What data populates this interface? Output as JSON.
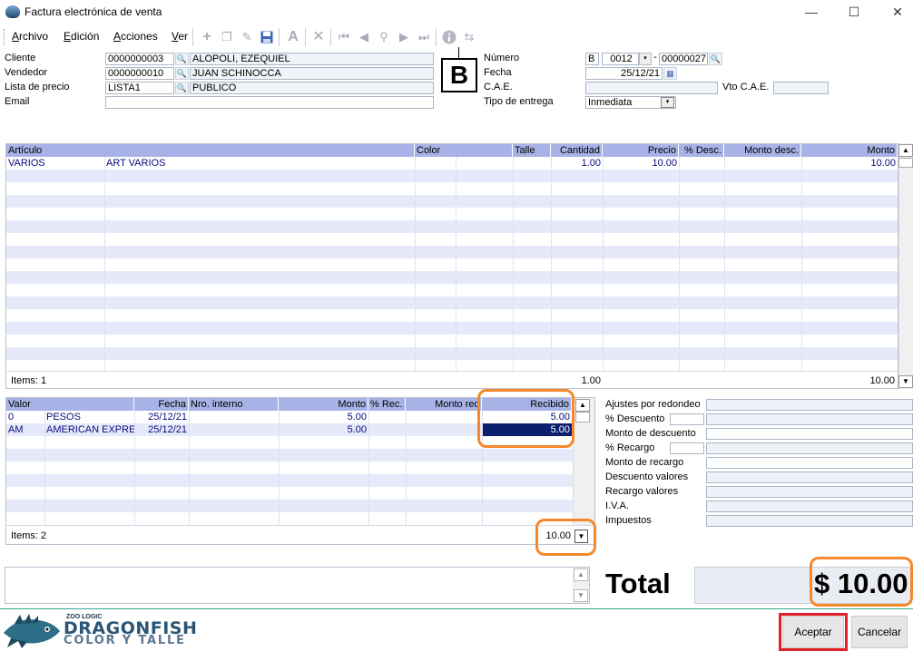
{
  "window": {
    "title": "Factura electrónica de venta",
    "minimize": "—",
    "maximize": "☐",
    "close": "✕"
  },
  "menu": {
    "items": [
      "Archivo",
      "Edición",
      "Acciones",
      "Ver"
    ]
  },
  "toolbar": {
    "icons": [
      "add-icon",
      "copy-icon",
      "edit-icon",
      "save-icon",
      "font-icon",
      "delete-icon",
      "first-icon",
      "prev-icon",
      "search-icon",
      "next-icon",
      "last-icon",
      "info-icon",
      "refresh-icon"
    ]
  },
  "header": {
    "cliente_label": "Cliente",
    "cliente_code": "0000000003",
    "cliente_name": "ALOPOLI, EZEQUIEL",
    "vendedor_label": "Vendedor",
    "vendedor_code": "0000000010",
    "vendedor_name": "JUAN SCHINOCCA",
    "lista_label": "Lista de precio",
    "lista_code": "LISTA1",
    "lista_name": "PUBLICO",
    "email_label": "Email",
    "email_value": "",
    "letter": "B",
    "numero_label": "Número",
    "numero_letter": "B",
    "numero_pv": "0012",
    "numero_dash": "-",
    "numero_num": "00000027",
    "fecha_label": "Fecha",
    "fecha_value": "25/12/21",
    "cae_label": "C.A.E.",
    "cae_value": "",
    "vto_label": "Vto C.A.E.",
    "vto_value": "",
    "entrega_label": "Tipo de entrega",
    "entrega_value": "Inmediata"
  },
  "articles": {
    "headers": [
      "Artículo",
      "Color",
      "Talle",
      "Cantidad",
      "Precio",
      "% Desc.",
      "Monto desc.",
      "Monto"
    ],
    "rows": [
      {
        "codigo": "VARIOS",
        "descripcion": "ART VARIOS",
        "color": "",
        "talle": "",
        "cantidad": "1.00",
        "precio": "10.00",
        "desc": "",
        "monto_desc": "",
        "monto": "10.00"
      }
    ],
    "items_label": "Items: 1",
    "total_cantidad": "1.00",
    "total_monto": "10.00"
  },
  "values": {
    "headers": [
      "Valor",
      "Fecha",
      "Nro. interno",
      "Monto",
      "% Rec.",
      "Monto rec",
      "Recibido"
    ],
    "rows": [
      {
        "codigo": "0",
        "nombre": "PESOS",
        "fecha": "25/12/21",
        "nro": "",
        "monto": "5.00",
        "rec": "",
        "monto_rec": "",
        "recibido": "5.00"
      },
      {
        "codigo": "AM",
        "nombre": "AMERICAN EXPRESS",
        "fecha": "25/12/21",
        "nro": "",
        "monto": "5.00",
        "rec": "",
        "monto_rec": "",
        "recibido": "5.00"
      }
    ],
    "items_label": "Items: 2",
    "total_recibido": "10.00"
  },
  "adjustments": {
    "redondeo": "Ajustes por redondeo",
    "descuento_pct": "% Descuento",
    "monto_descuento": "Monto de descuento",
    "recargo_pct": "% Recargo",
    "monto_recargo": "Monto de recargo",
    "descuento_valores": "Descuento valores",
    "recargo_valores": "Recargo valores",
    "iva": "I.V.A.",
    "impuestos": "Impuestos"
  },
  "total": {
    "label": "Total",
    "value": "$ 10.00"
  },
  "brand": {
    "zoo": "ZOO LOGIC",
    "name": "DRAGONFISH",
    "sub": "COLOR Y TALLE"
  },
  "buttons": {
    "aceptar": "Aceptar",
    "cancelar": "Cancelar"
  },
  "colors": {
    "header_row": "#a7b3e6",
    "stripe": "#e6e9f9",
    "highlight_orange": "#f5882a",
    "highlight_red": "#e0202a",
    "selected_cell": "#0b1f6e"
  }
}
